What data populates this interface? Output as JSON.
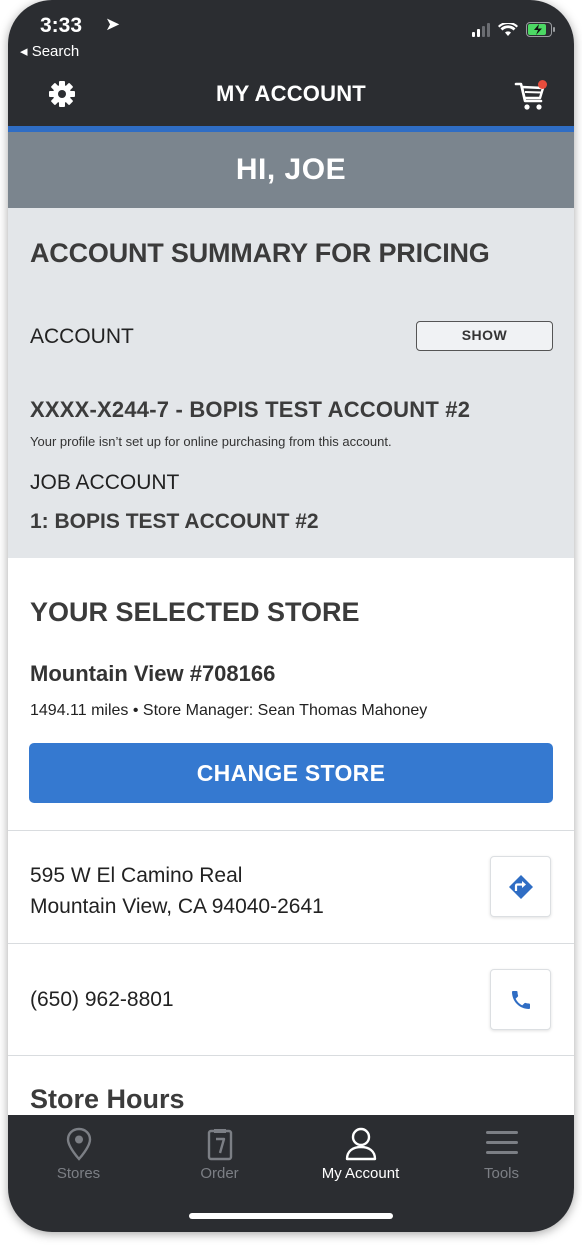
{
  "status_bar": {
    "time": "3:33",
    "location_arrow": "➤",
    "back_label": "◂ Search"
  },
  "header": {
    "title": "MY ACCOUNT",
    "settings_icon": "gear-icon",
    "cart_icon": "cart-icon",
    "cart_badge_color": "#e74c3c"
  },
  "colors": {
    "nav_bg": "#2b2d31",
    "accent": "#2f6dc4",
    "greeting_bg": "#7b858e",
    "summary_bg": "#e3e6e9",
    "button_blue": "#3579d0"
  },
  "greeting": "HI, JOE",
  "account_summary": {
    "title": "ACCOUNT SUMMARY FOR PRICING",
    "account_label": "ACCOUNT",
    "show_label": "SHOW",
    "account_number": "XXXX-X244-7 - BOPIS TEST ACCOUNT #2",
    "note": "Your profile isn’t set up for online purchasing from this account.",
    "job_label": "JOB ACCOUNT",
    "job_value": "1: BOPIS TEST ACCOUNT #2"
  },
  "store": {
    "section_title": "YOUR SELECTED STORE",
    "name": "Mountain View #708166",
    "meta": "1494.11 miles • Store Manager: Sean Thomas Mahoney",
    "change_label": "CHANGE STORE",
    "address_line1": "595 W El Camino Real",
    "address_line2": "Mountain View, CA 94040-2641",
    "phone": "(650) 962-8801",
    "hours_title": "Store Hours"
  },
  "tabs": [
    {
      "label": "Stores",
      "icon": "location-pin-icon",
      "active": false
    },
    {
      "label": "Order",
      "icon": "clipboard-icon",
      "active": false
    },
    {
      "label": "My Account",
      "icon": "user-icon",
      "active": true
    },
    {
      "label": "Tools",
      "icon": "menu-icon",
      "active": false
    }
  ]
}
